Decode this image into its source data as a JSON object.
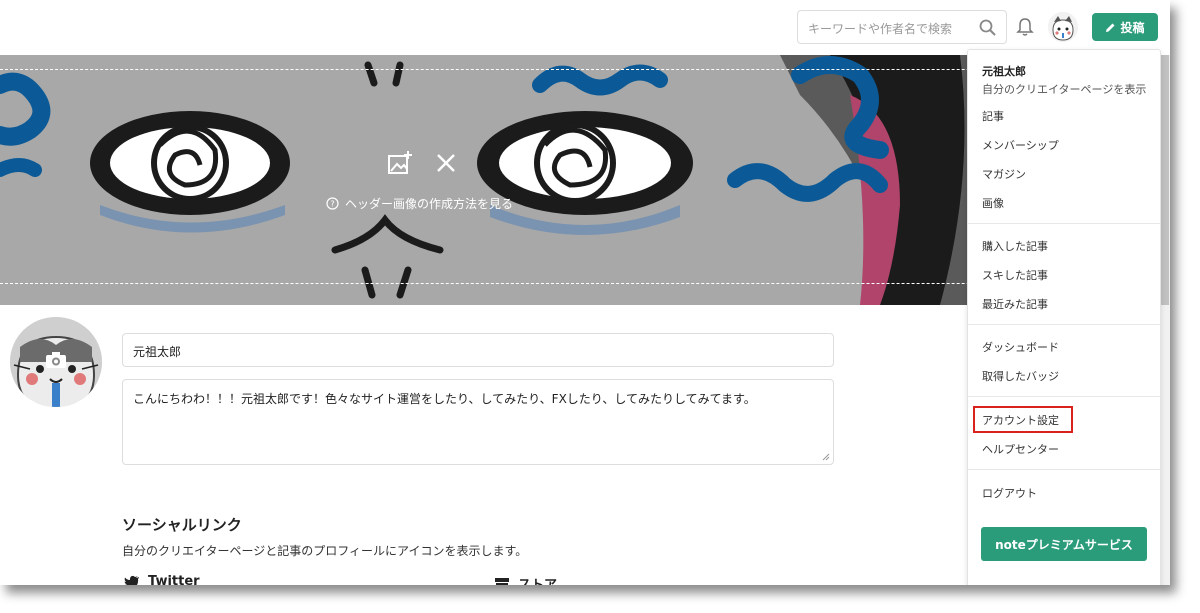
{
  "search": {
    "placeholder": "キーワードや作者名で検索"
  },
  "toolbar": {
    "post_label": "投稿"
  },
  "header": {
    "help_link": "ヘッダー画像の作成方法を見る"
  },
  "profile": {
    "name": "元祖太郎",
    "bio": "こんにちわわ！！！元祖太郎です！色々なサイト運営をしたり、してみたり、FXしたり、してみたりしてみてます。"
  },
  "social": {
    "title": "ソーシャルリンク",
    "description": "自分のクリエイターページと記事のプロフィールにアイコンを表示します。",
    "twitter": "Twitter",
    "store": "ストア"
  },
  "menu": {
    "user_name": "元祖太郎",
    "user_sub": "自分のクリエイターページを表示",
    "items": [
      "記事",
      "メンバーシップ",
      "マガジン",
      "画像",
      "購入した記事",
      "スキした記事",
      "最近みた記事",
      "ダッシュボード",
      "取得したバッジ",
      "アカウント設定",
      "ヘルプセンター",
      "ログアウト"
    ],
    "premium": "noteプレミアムサービス"
  },
  "colors": {
    "accent_green": "#2a9c7a",
    "highlight_red": "#d9221c",
    "header_gray": "#a8a8a8",
    "art_blue": "#0b5a97",
    "art_pink": "#b0446a"
  }
}
